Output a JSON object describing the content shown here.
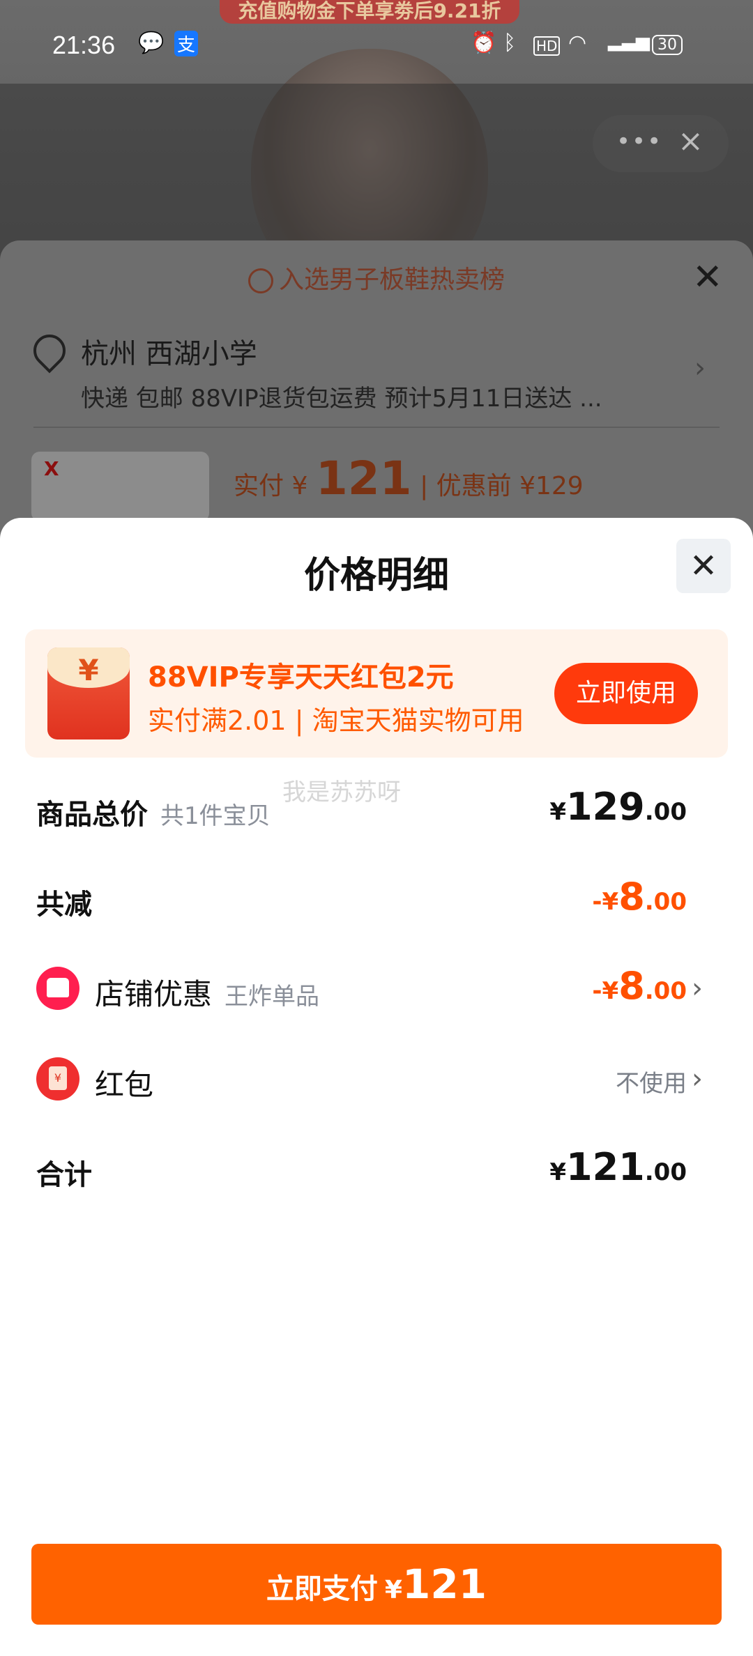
{
  "status_bar": {
    "time": "21:36",
    "icons": [
      "wechat-icon",
      "alipay-icon",
      "alarm-icon",
      "bluetooth-icon",
      "hd-icon",
      "wifi-icon",
      "signal-5g-icon",
      "battery-icon"
    ],
    "battery": "30"
  },
  "background": {
    "promo_banner": "充值购物金下单享劵后9.21折"
  },
  "behind_sheet": {
    "badge": "入选男子板鞋热卖榜",
    "address_title": "杭州 西湖小学",
    "address_sub": "快递 包邮 88VIP退货包运费 预计5月11日送达 ...",
    "product_logo": "X",
    "paid_label": "实付",
    "paid_currency": "¥",
    "paid_amount": "121",
    "original_label": "| 优惠前 ¥129"
  },
  "sheet": {
    "title": "价格明细",
    "voucher": {
      "title": "88VIP专享天天红包2元",
      "subtitle": "实付满2.01 | 淘宝天猫实物可用",
      "button": "立即使用",
      "icon_glyph": "¥"
    },
    "watermark": "我是苏苏呀",
    "rows": {
      "total": {
        "label": "商品总价",
        "sub": "共1件宝贝",
        "currency": "¥",
        "int": "129",
        "dec": ".00"
      },
      "reduction": {
        "label": "共减",
        "currency": "-¥",
        "int": "8",
        "dec": ".00"
      },
      "shop_discount": {
        "label": "店铺优惠",
        "sub": "王炸单品",
        "currency": "-¥",
        "int": "8",
        "dec": ".00"
      },
      "red_packet": {
        "label": "红包",
        "value": "不使用",
        "icon_glyph": "¥"
      },
      "sum": {
        "label": "合计",
        "currency": "¥",
        "int": "121",
        "dec": ".00"
      }
    },
    "pay_button": {
      "label": "立即支付",
      "currency": "¥",
      "amount": "121"
    }
  },
  "colors": {
    "accent": "#ff5000",
    "pay_button": "#ff6200",
    "voucher_bg": "#fff3ea"
  }
}
